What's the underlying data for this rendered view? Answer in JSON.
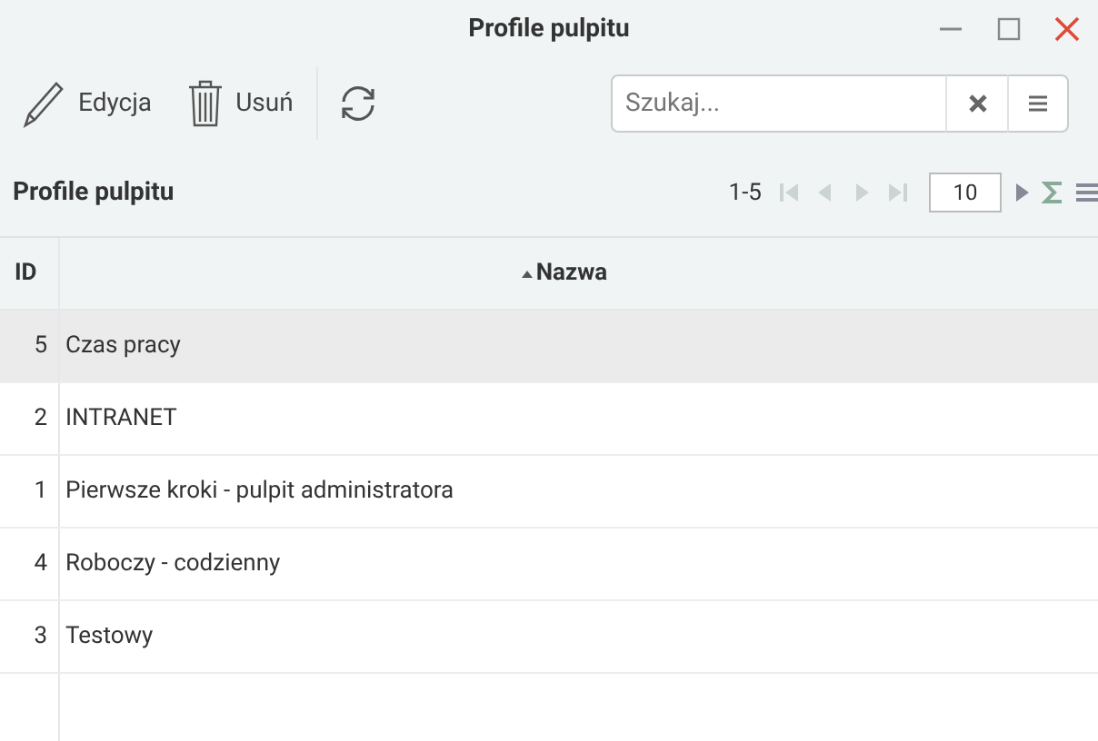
{
  "window": {
    "title": "Profile pulpitu"
  },
  "toolbar": {
    "buttons": [
      {
        "kind": "edit",
        "label": "Edycja"
      },
      {
        "kind": "delete",
        "label": "Usuń"
      },
      {
        "kind": "refresh"
      }
    ],
    "search": {
      "placeholder": "Szukaj..."
    }
  },
  "grid_header": {
    "title": "Profile pulpitu",
    "range": "1-5",
    "nav": [
      {
        "kind": "first",
        "disabled": true
      },
      {
        "kind": "prev",
        "disabled": true
      },
      {
        "kind": "next",
        "disabled": true
      },
      {
        "kind": "last",
        "disabled": true
      }
    ],
    "page_size": "10"
  },
  "table": {
    "columns": [
      {
        "label": "ID",
        "sorted": false
      },
      {
        "label": "Nazwa",
        "sorted": true
      }
    ],
    "rows": [
      {
        "id": "5",
        "name": "Czas pracy",
        "selected": true
      },
      {
        "id": "2",
        "name": "INTRANET",
        "selected": false
      },
      {
        "id": "1",
        "name": "Pierwsze kroki - pulpit administratora",
        "selected": false
      },
      {
        "id": "4",
        "name": "Roboczy - codzienny",
        "selected": false
      },
      {
        "id": "3",
        "name": "Testowy",
        "selected": false
      }
    ]
  }
}
